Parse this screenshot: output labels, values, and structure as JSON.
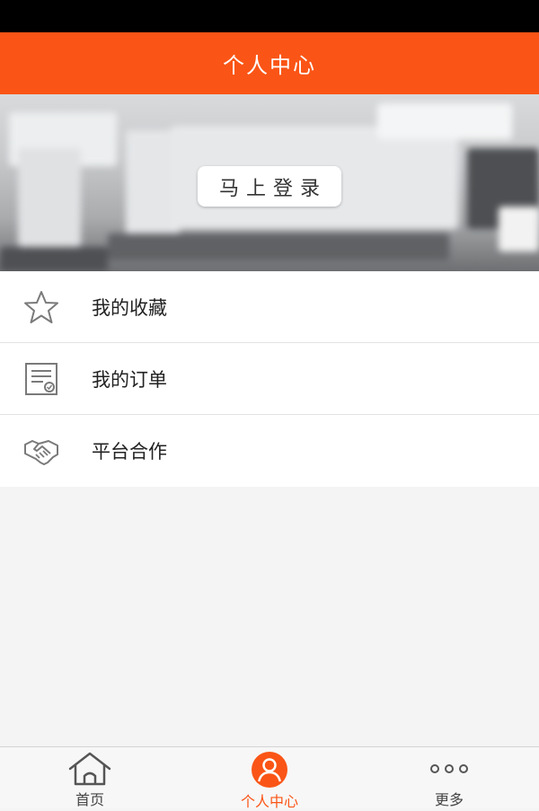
{
  "header": {
    "title": "个人中心"
  },
  "banner": {
    "login_label": "马上登录"
  },
  "menu": {
    "items": [
      {
        "label": "我的收藏",
        "icon": "star-icon"
      },
      {
        "label": "我的订单",
        "icon": "order-document-icon"
      },
      {
        "label": "平台合作",
        "icon": "handshake-icon"
      }
    ]
  },
  "tabbar": {
    "tabs": [
      {
        "label": "首页",
        "icon": "home-icon",
        "active": false
      },
      {
        "label": "个人中心",
        "icon": "user-icon",
        "active": true
      },
      {
        "label": "更多",
        "icon": "more-dots-icon",
        "active": false
      }
    ]
  },
  "colors": {
    "accent": "#fa5516",
    "status_bar": "#000000",
    "background": "#f4f4f4"
  }
}
